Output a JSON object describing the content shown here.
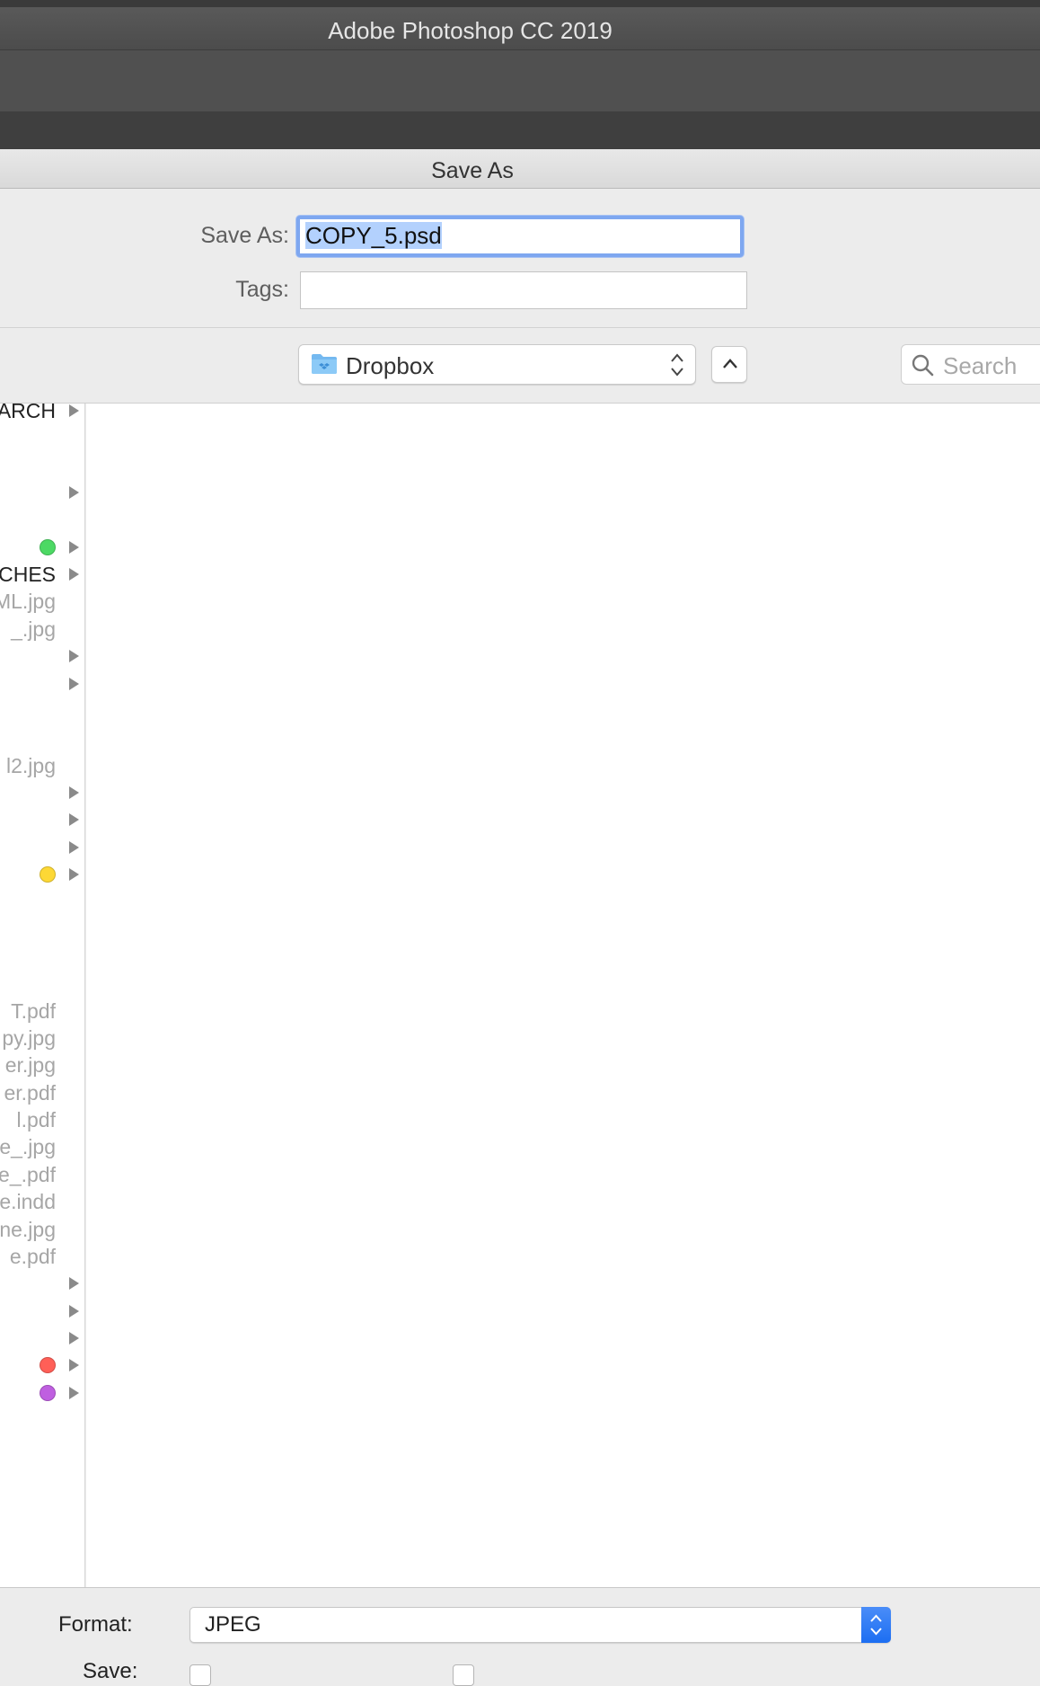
{
  "app": {
    "title": "Adobe Photoshop CC 2019"
  },
  "dialog": {
    "title": "Save As",
    "save_as_label": "Save As:",
    "filename_selected": "COPY_5.psd",
    "tags_label": "Tags:",
    "tags_value": ""
  },
  "location": {
    "folder": "Dropbox",
    "folder_icon": "dropbox-folder-icon",
    "search_placeholder": "Search"
  },
  "sidebar": {
    "rows": [
      {
        "label": "ARCH",
        "kind": "folder",
        "arrow": true,
        "tag": null
      },
      {
        "label": "",
        "kind": "blank",
        "arrow": false,
        "tag": null
      },
      {
        "label": "",
        "kind": "blank",
        "arrow": false,
        "tag": null
      },
      {
        "label": "",
        "kind": "folder",
        "arrow": true,
        "tag": null
      },
      {
        "label": "",
        "kind": "blank",
        "arrow": false,
        "tag": null
      },
      {
        "label": "",
        "kind": "folder",
        "arrow": true,
        "tag": "#4cd964"
      },
      {
        "label": "CHES",
        "kind": "folder",
        "arrow": true,
        "tag": null
      },
      {
        "label": "ML.jpg",
        "kind": "file",
        "arrow": false,
        "tag": null
      },
      {
        "label": "_.jpg",
        "kind": "file",
        "arrow": false,
        "tag": null
      },
      {
        "label": "",
        "kind": "folder",
        "arrow": true,
        "tag": null
      },
      {
        "label": "",
        "kind": "folder",
        "arrow": true,
        "tag": null
      },
      {
        "label": "",
        "kind": "blank",
        "arrow": false,
        "tag": null
      },
      {
        "label": "",
        "kind": "blank",
        "arrow": false,
        "tag": null
      },
      {
        "label": "l2.jpg",
        "kind": "file",
        "arrow": false,
        "tag": null
      },
      {
        "label": "",
        "kind": "folder",
        "arrow": true,
        "tag": null
      },
      {
        "label": "",
        "kind": "folder",
        "arrow": true,
        "tag": null
      },
      {
        "label": "",
        "kind": "folder",
        "arrow": true,
        "tag": null
      },
      {
        "label": "",
        "kind": "folder",
        "arrow": true,
        "tag": "#fdd835"
      },
      {
        "label": "",
        "kind": "blank",
        "arrow": false,
        "tag": null
      },
      {
        "label": "",
        "kind": "blank",
        "arrow": false,
        "tag": null
      },
      {
        "label": "",
        "kind": "blank",
        "arrow": false,
        "tag": null
      },
      {
        "label": "",
        "kind": "blank",
        "arrow": false,
        "tag": null
      },
      {
        "label": "T.pdf",
        "kind": "file",
        "arrow": false,
        "tag": null
      },
      {
        "label": "py.jpg",
        "kind": "file",
        "arrow": false,
        "tag": null
      },
      {
        "label": "er.jpg",
        "kind": "file",
        "arrow": false,
        "tag": null
      },
      {
        "label": "er.pdf",
        "kind": "file",
        "arrow": false,
        "tag": null
      },
      {
        "label": "l.pdf",
        "kind": "file",
        "arrow": false,
        "tag": null
      },
      {
        "label": "e_.jpg",
        "kind": "file",
        "arrow": false,
        "tag": null
      },
      {
        "label": "e_.pdf",
        "kind": "file",
        "arrow": false,
        "tag": null
      },
      {
        "label": "e.indd",
        "kind": "file",
        "arrow": false,
        "tag": null
      },
      {
        "label": "ne.jpg",
        "kind": "file",
        "arrow": false,
        "tag": null
      },
      {
        "label": "e.pdf",
        "kind": "file",
        "arrow": false,
        "tag": null
      },
      {
        "label": "",
        "kind": "folder",
        "arrow": true,
        "tag": null
      },
      {
        "label": "",
        "kind": "folder",
        "arrow": true,
        "tag": null
      },
      {
        "label": "",
        "kind": "folder",
        "arrow": true,
        "tag": null
      },
      {
        "label": "",
        "kind": "folder",
        "arrow": true,
        "tag": "#ff5f57"
      },
      {
        "label": "",
        "kind": "folder",
        "arrow": true,
        "tag": "#bf5fe0"
      }
    ]
  },
  "options": {
    "format_label": "Format:",
    "format_value": "JPEG",
    "save_label": "Save:"
  },
  "colors": {
    "accent": "#1c6ef2",
    "focus_ring": "#7ea7f0",
    "selection": "#b3d1fd"
  }
}
